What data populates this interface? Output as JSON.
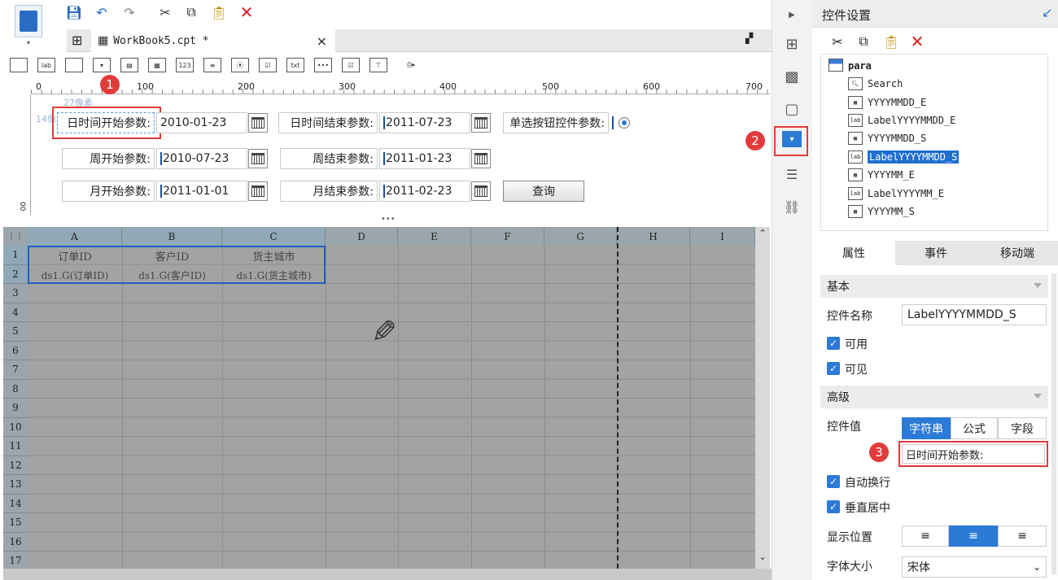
{
  "toolbar": {
    "save": "save",
    "undo": "undo",
    "redo": "redo",
    "cut": "cut",
    "copy": "copy",
    "paste": "paste",
    "delete": "delete"
  },
  "tab": {
    "title": "WorkBook5.cpt *",
    "close": "×"
  },
  "widget_icons": [
    "lab",
    "123",
    "txt"
  ],
  "ruler": {
    "ticks": [
      "0",
      "100",
      "200",
      "300",
      "400",
      "500",
      "600",
      "700"
    ],
    "vticks": [
      "00"
    ],
    "hint": "27像素",
    "hint2": "14像"
  },
  "params": {
    "day_start_label": "日时间开始参数:",
    "day_start_value": "2010-01-23",
    "day_end_label": "日时间结束参数:",
    "day_end_value": "2011-07-23",
    "radio_label": "单选按钮控件参数:",
    "week_start_label": "周开始参数:",
    "week_start_value": "2010-07-23",
    "week_end_label": "周结束参数:",
    "week_end_value": "2011-01-23",
    "month_start_label": "月开始参数:",
    "month_start_value": "2011-01-01",
    "month_end_label": "月结束参数:",
    "month_end_value": "2011-02-23",
    "query_button": "查询"
  },
  "sheet": {
    "columns": [
      "A",
      "B",
      "C",
      "D",
      "E",
      "F",
      "G",
      "H",
      "I"
    ],
    "rows": [
      "1",
      "2",
      "3",
      "4",
      "5",
      "6",
      "7",
      "8",
      "9",
      "10",
      "11",
      "12",
      "13",
      "14",
      "15",
      "16",
      "17"
    ],
    "header_row": [
      "订单ID",
      "客户ID",
      "货主城市"
    ],
    "data_row": [
      "ds1.G(订单ID)",
      "ds1.G(客户ID)",
      "ds1.G(货主城市)"
    ]
  },
  "panel": {
    "title": "控件设置",
    "tree": [
      "para",
      "Search",
      "YYYYMMDD_E",
      "LabelYYYYMMDD_E",
      "YYYYMMDD_S",
      "LabelYYYYMMDD_S",
      "YYYYMM_E",
      "LabelYYYYMM_E",
      "YYYYMM_S"
    ],
    "tabs": [
      "属性",
      "事件",
      "移动端"
    ],
    "basic": "基本",
    "name_label": "控件名称",
    "name_value": "LabelYYYYMMDD_S",
    "enabled": "可用",
    "visible": "可见",
    "advanced": "高级",
    "value_label": "控件值",
    "value_modes": [
      "字符串",
      "公式",
      "字段"
    ],
    "value_text": "日时间开始参数:",
    "autowrap": "自动换行",
    "vcenter": "垂直居中",
    "align_label": "显示位置",
    "font_label": "字体大小",
    "font_value": "宋体"
  },
  "badges": [
    "1",
    "2",
    "3"
  ],
  "colors": {
    "accent": "#2b7ad6",
    "selected": "#1f6fd0",
    "badge": "#e23b3b",
    "grid": "#9aa6ab",
    "sheet": "#a3a3a3"
  }
}
